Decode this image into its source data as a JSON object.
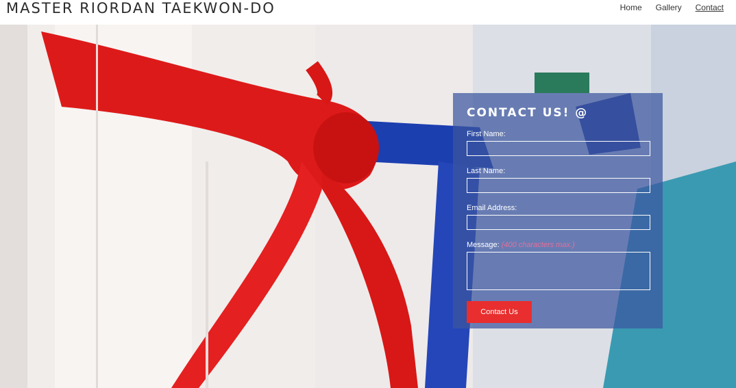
{
  "header": {
    "site_title": "MASTER RIORDAN TAEKWON-DO",
    "nav": [
      {
        "label": "Home",
        "active": false
      },
      {
        "label": "Gallery",
        "active": false
      },
      {
        "label": "Contact",
        "active": true
      }
    ]
  },
  "contact": {
    "title": "CONTACT US! @",
    "fields": {
      "first_name": {
        "label": "First Name:",
        "value": ""
      },
      "last_name": {
        "label": "Last Name:",
        "value": ""
      },
      "email": {
        "label": "Email Address:",
        "value": ""
      },
      "message": {
        "label": "Message:",
        "hint": "(400 characters max.)",
        "value": ""
      }
    },
    "submit_label": "Contact Us"
  },
  "colors": {
    "panel_bg": "#3c56a0",
    "button_bg": "#e82e2e",
    "red_belt": "#e01b1b",
    "blue_belt": "#1c3fb0"
  }
}
